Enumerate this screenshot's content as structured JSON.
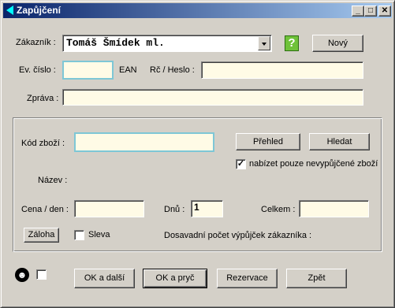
{
  "window": {
    "title": "Zapůjčení",
    "minimize_glyph": "_",
    "maximize_glyph": "□",
    "close_glyph": "✕"
  },
  "customer": {
    "label": "Zákazník :",
    "value": "Tomáš Šmídek ml.",
    "help_glyph": "?",
    "new_button": "Nový"
  },
  "evidence": {
    "label": "Ev. číslo :",
    "value": "",
    "ean_label": "EAN",
    "rc_label": "Rč / Heslo :",
    "rc_value": ""
  },
  "message": {
    "label": "Zpráva :",
    "value": ""
  },
  "item": {
    "code_label": "Kód zboží :",
    "code_value": "",
    "overview_button": "Přehled",
    "search_button": "Hledat",
    "only_available_label": "nabízet pouze nevypůjčené zboží",
    "only_available_checked": true,
    "name_label": "Název :",
    "price_label": "Cena / den :",
    "price_value": "",
    "days_label": "Dnů :",
    "days_value": "1",
    "total_label": "Celkem :",
    "total_value": "",
    "deposit_button": "Záloha",
    "discount_label": "Sleva",
    "discount_checked": false,
    "history_label": "Dosavadní počet výpůjček zákazníka :"
  },
  "footer": {
    "user_icon": "person-icon",
    "extra_checked": false,
    "ok_next": "OK a další",
    "ok_close": "OK a pryč",
    "reservation": "Rezervace",
    "back": "Zpět"
  }
}
